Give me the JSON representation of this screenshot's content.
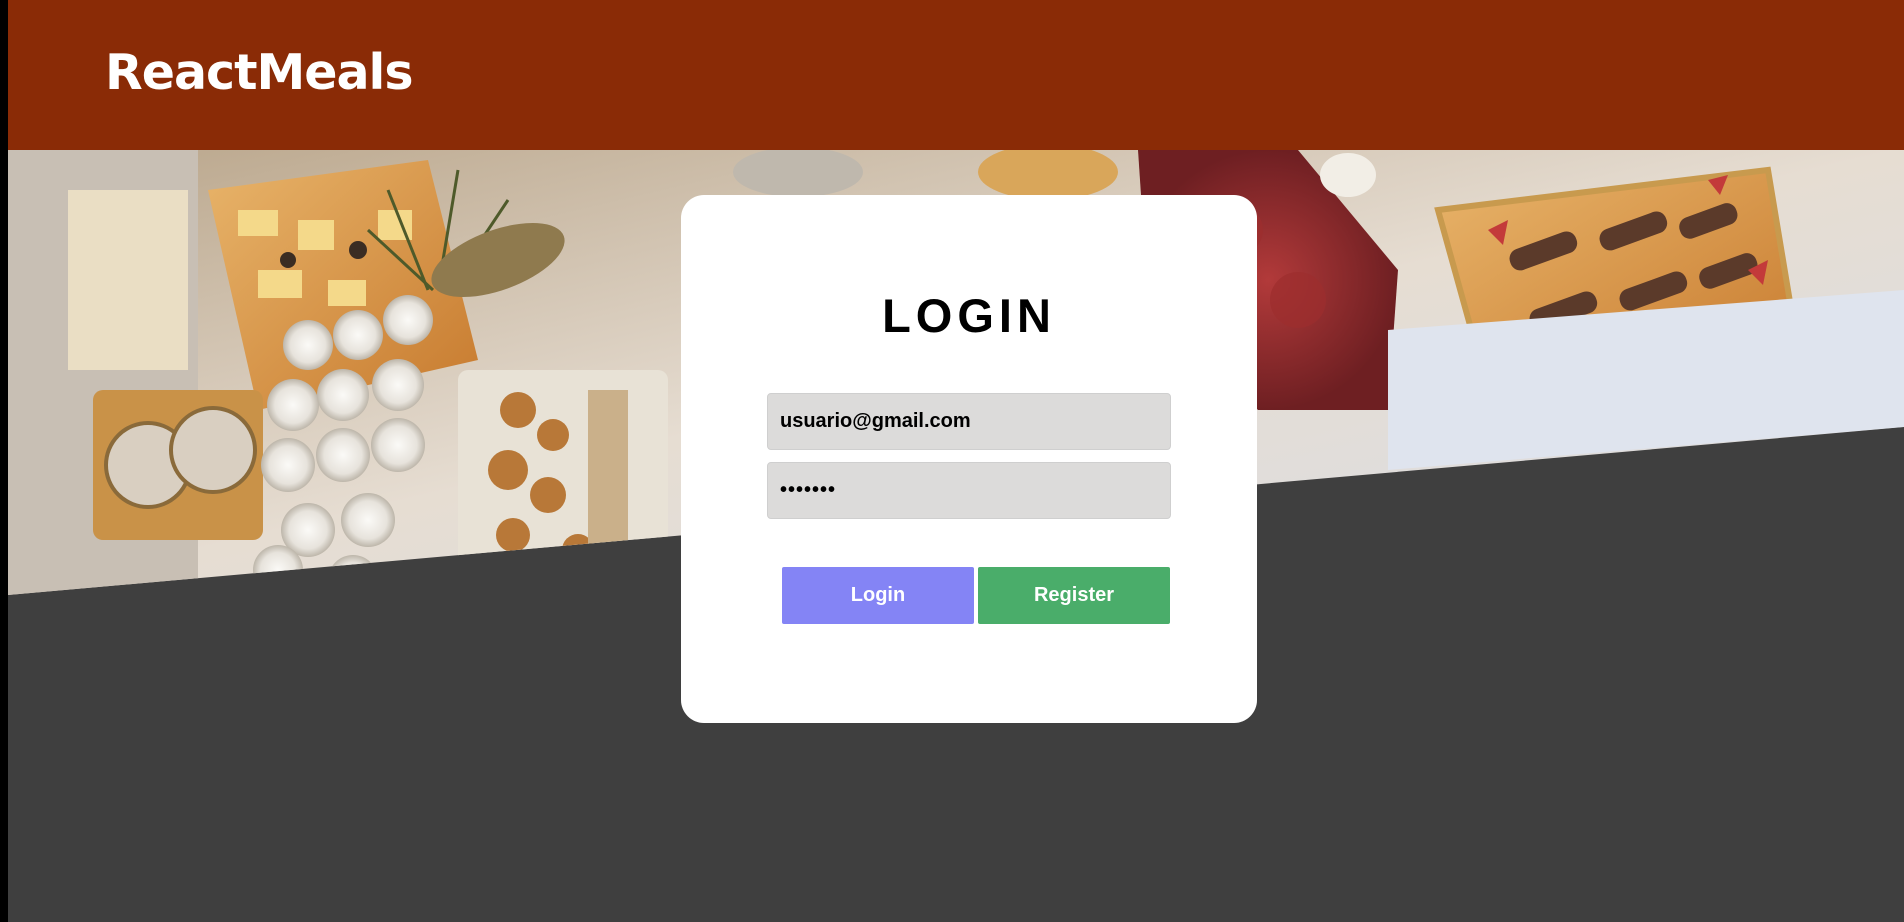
{
  "header": {
    "brand": "ReactMeals"
  },
  "login_form": {
    "title": "LOGIN",
    "email_value": "usuario@gmail.com",
    "password_value": "1234567",
    "login_label": "Login",
    "register_label": "Register"
  },
  "colors": {
    "header_bg": "#8a2b06",
    "page_bg": "#3f3f3f",
    "card_bg": "#ffffff",
    "input_bg": "#dcdbda",
    "login_button": "#8484f5",
    "register_button": "#4aad6a"
  },
  "icons": {
    "banner": "food-buffet-photo"
  }
}
